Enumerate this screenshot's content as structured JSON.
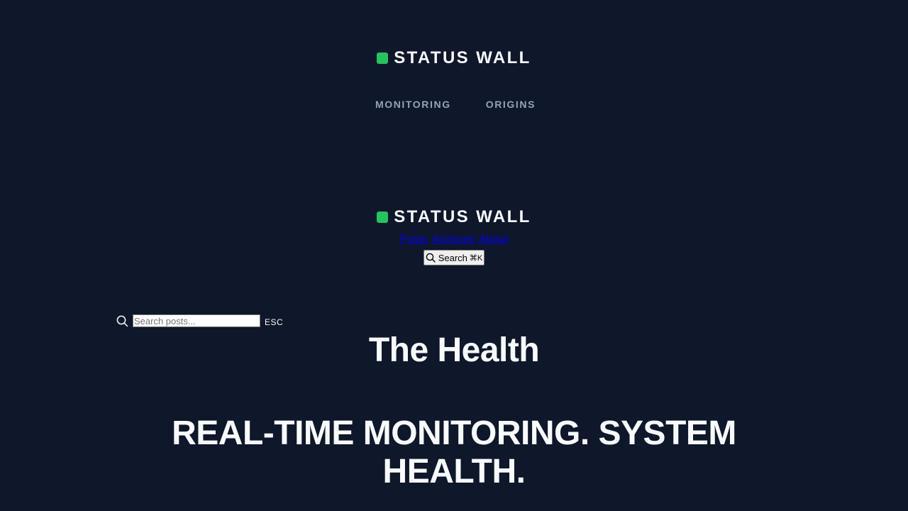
{
  "header": {
    "brand": "STATUS WALL",
    "brand_color": "#22c55e",
    "nav": [
      {
        "label": "MONITORING"
      },
      {
        "label": "ORIGINS"
      }
    ]
  },
  "secondary_header": {
    "brand": "STATUS WALL",
    "nav": [
      {
        "label": "Posts"
      },
      {
        "label": "Archives"
      },
      {
        "label": "About"
      }
    ],
    "search_button": {
      "label": "Search",
      "shortcut": "⌘K",
      "icon": "search-icon"
    }
  },
  "search": {
    "placeholder": "Search posts...",
    "value": "",
    "close_hint": "ESC",
    "icon": "search-icon"
  },
  "main": {
    "title": "The Health",
    "tagline_line1": "REAL-TIME MONITORING. SYSTEM",
    "tagline_line2": "HEALTH."
  },
  "colors": {
    "background": "#0f172a",
    "text": "#f8fafc",
    "nav_muted": "#94a3b8",
    "accent": "#22c55e"
  }
}
